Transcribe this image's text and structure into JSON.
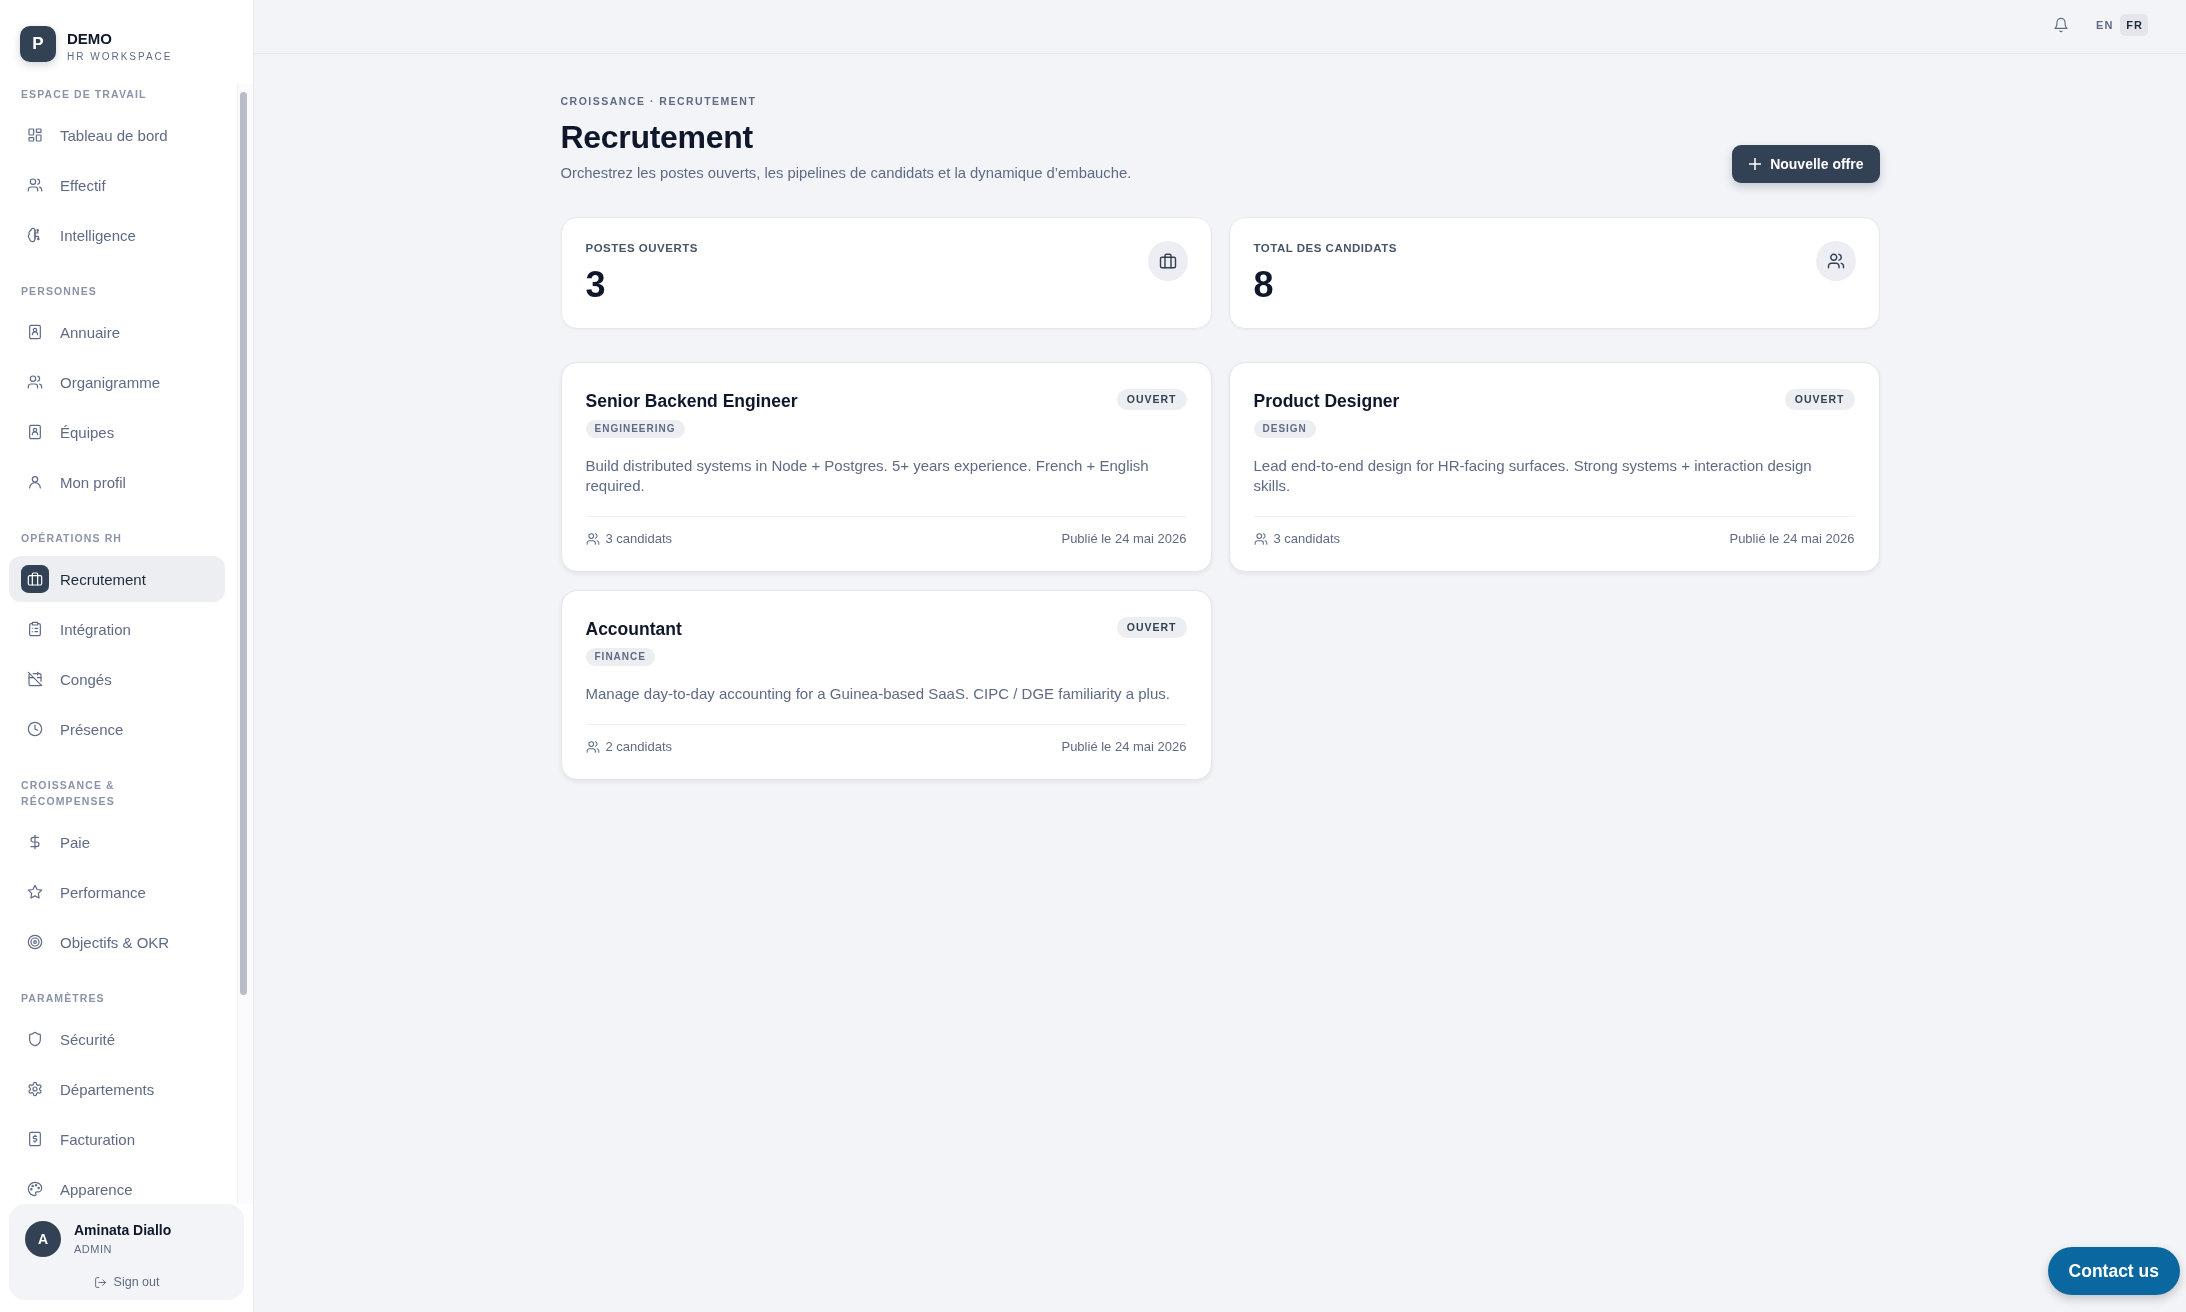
{
  "sidebar": {
    "brand": {
      "logo_letter": "P",
      "name": "DEMO",
      "subtitle": "HR WORKSPACE"
    },
    "sections": [
      {
        "title": "ESPACE DE TRAVAIL",
        "items": [
          {
            "label": "Tableau de bord",
            "selected": false
          },
          {
            "label": "Effectif",
            "selected": false
          },
          {
            "label": "Intelligence",
            "selected": false
          }
        ]
      },
      {
        "title": "PERSONNES",
        "items": [
          {
            "label": "Annuaire",
            "selected": false
          },
          {
            "label": "Organigramme",
            "selected": false
          },
          {
            "label": "Équipes",
            "selected": false
          },
          {
            "label": "Mon profil",
            "selected": false
          }
        ]
      },
      {
        "title": "OPÉRATIONS RH",
        "items": [
          {
            "label": "Recrutement",
            "selected": true
          },
          {
            "label": "Intégration",
            "selected": false
          },
          {
            "label": "Congés",
            "selected": false
          },
          {
            "label": "Présence",
            "selected": false
          }
        ]
      },
      {
        "title": "CROISSANCE & RÉCOMPENSES",
        "items": [
          {
            "label": "Paie",
            "selected": false
          },
          {
            "label": "Performance",
            "selected": false
          },
          {
            "label": "Objectifs & OKR",
            "selected": false
          }
        ]
      },
      {
        "title": "PARAMÈTRES",
        "items": [
          {
            "label": "Sécurité",
            "selected": false
          },
          {
            "label": "Départements",
            "selected": false
          },
          {
            "label": "Facturation",
            "selected": false
          },
          {
            "label": "Apparence",
            "selected": false
          }
        ]
      }
    ],
    "user": {
      "avatar_letter": "A",
      "name": "Aminata Diallo",
      "role": "ADMIN",
      "sign_out": "Sign out"
    }
  },
  "top_bar": {
    "languages": [
      {
        "label": "EN",
        "selected": false
      },
      {
        "label": "FR",
        "selected": true
      }
    ]
  },
  "header": {
    "breadcrumb": "CROISSANCE · RECRUTEMENT",
    "title": "Recrutement",
    "subtitle": "Orchestrez les postes ouverts, les pipelines de candidats et la dynamique d’embauche.",
    "primary_button": "Nouvelle offre"
  },
  "stats": [
    {
      "label": "POSTES OUVERTS",
      "value": "3"
    },
    {
      "label": "TOTAL DES CANDIDATS",
      "value": "8"
    }
  ],
  "jobs": [
    {
      "title": "Senior Backend Engineer",
      "status": "OUVERT",
      "department": "ENGINEERING",
      "description": "Build distributed systems in Node + Postgres. 5+ years experience. French + English required.",
      "candidates": "3 candidats",
      "published": "Publié le 24 mai 2026"
    },
    {
      "title": "Product Designer",
      "status": "OUVERT",
      "department": "DESIGN",
      "description": "Lead end-to-end design for HR-facing surfaces. Strong systems + interaction design skills.",
      "candidates": "3 candidats",
      "published": "Publié le 24 mai 2026"
    },
    {
      "title": "Accountant",
      "status": "OUVERT",
      "department": "FINANCE",
      "description": "Manage day-to-day accounting for a Guinea-based SaaS. CIPC / DGE familiarity a plus.",
      "candidates": "2 candidats",
      "published": "Publié le 24 mai 2026"
    }
  ],
  "contact_button": "Contact us"
}
